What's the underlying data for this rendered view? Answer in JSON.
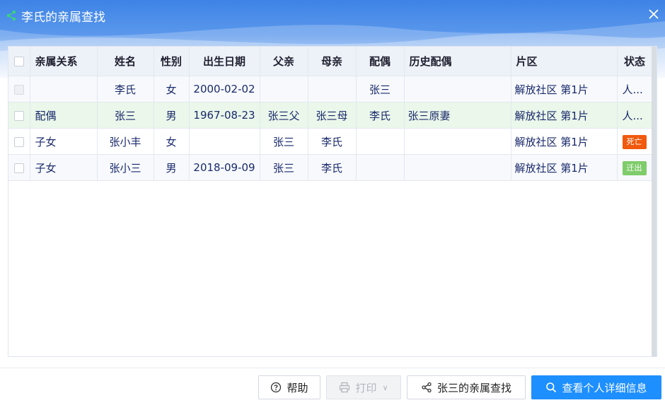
{
  "window": {
    "title": "李氏的亲属查找",
    "close_icon": "close-icon",
    "title_icon": "share-icon"
  },
  "table": {
    "columns": [
      "亲属关系",
      "姓名",
      "性别",
      "出生日期",
      "父亲",
      "母亲",
      "配偶",
      "历史配偶",
      "片区",
      "状态"
    ],
    "rows": [
      {
        "relation": "",
        "name": "李氏",
        "gender": "女",
        "birth": "2000-02-02",
        "father": "",
        "mother": "",
        "spouse": "张三",
        "history_spouse": "",
        "district": "解放社区 第1片",
        "status": "人...",
        "checkbox_disabled": true
      },
      {
        "relation": "配偶",
        "name": "张三",
        "gender": "男",
        "birth": "1967-08-23",
        "father": "张三父",
        "mother": "张三母",
        "spouse": "李氏",
        "history_spouse": "张三原妻",
        "district": "解放社区 第1片",
        "status": "人..."
      },
      {
        "relation": "子女",
        "name": "张小丰",
        "gender": "女",
        "birth": "",
        "father": "张三",
        "mother": "李氏",
        "spouse": "",
        "history_spouse": "",
        "district": "解放社区 第1片",
        "status_badge": {
          "text": "死亡",
          "color": "#f15a0e"
        }
      },
      {
        "relation": "子女",
        "name": "张小三",
        "gender": "男",
        "birth": "2018-09-09",
        "father": "张三",
        "mother": "李氏",
        "spouse": "",
        "history_spouse": "",
        "district": "解放社区 第1片",
        "status_badge": {
          "text": "迁出",
          "color": "#7fcc6b"
        }
      }
    ]
  },
  "footer": {
    "help": {
      "label": "帮助",
      "icon": "question-circle-icon"
    },
    "print": {
      "label": "打印",
      "icon": "printer-icon",
      "disabled": true
    },
    "relatives": {
      "label": "张三的亲属查找",
      "icon": "share-icon"
    },
    "details": {
      "label": "查看个人详细信息",
      "icon": "search-icon"
    }
  },
  "colors": {
    "primary": "#1e8fff",
    "header_blue": "#3d83e6",
    "selected_row": "#eaf7ea"
  }
}
